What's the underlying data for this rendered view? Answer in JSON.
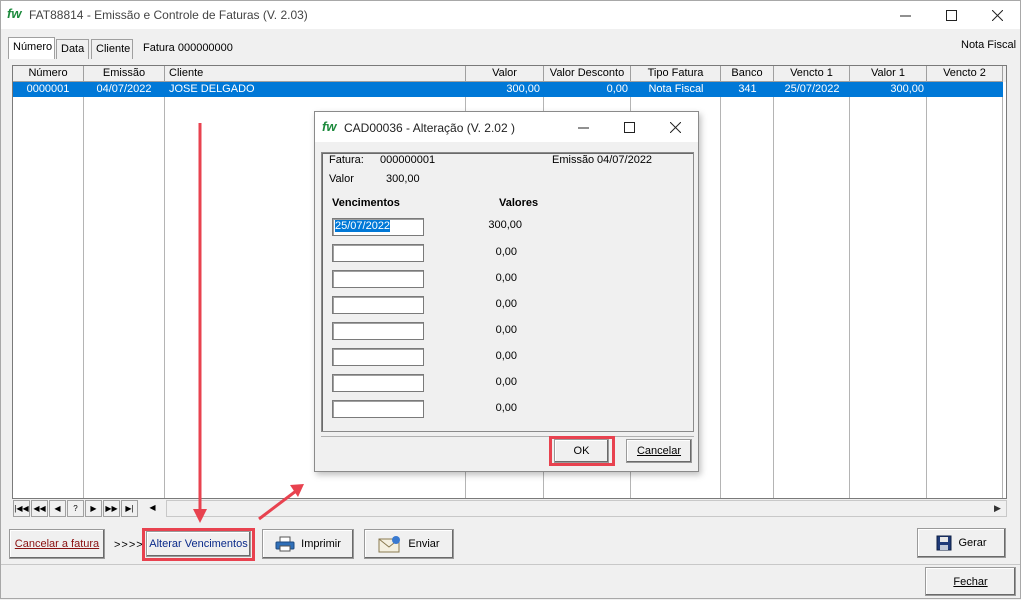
{
  "window": {
    "title": "FAT88814 - Emissão e Controle de  Faturas  (V. 2.03)",
    "logo": "fw"
  },
  "tabs": [
    "Número",
    "Data",
    "Cliente"
  ],
  "fatura_label": "Fatura 000000000",
  "nota_fiscal_label": "Nota Fiscal",
  "grid": {
    "columns": [
      "Número",
      "Emissão",
      "Cliente",
      "Valor",
      "Valor Desconto",
      "Tipo Fatura",
      "Banco",
      "Vencto 1",
      "Valor 1",
      "Vencto 2"
    ],
    "rows": [
      [
        "0000001",
        "04/07/2022",
        "JOSE DELGADO",
        "300,00",
        "0,00",
        "Nota Fiscal",
        "341",
        "25/07/2022",
        "300,00",
        ""
      ]
    ]
  },
  "navigator": [
    "|◀◀",
    "◀◀",
    "◀",
    "?",
    "▶",
    "▶▶",
    "▶|",
    "◀"
  ],
  "buttons": {
    "cancelar": "Cancelar a fatura",
    "arrows": ">>>>",
    "alterar": "Alterar Vencimentos",
    "imprimir": "Imprimir",
    "enviar": "Enviar",
    "gerar": "Gerar",
    "fechar": "Fechar"
  },
  "dialog": {
    "title": "CAD00036 - Alteração  (V.  2.02 )",
    "fatura_label": "Fatura:",
    "fatura_value": "000000001",
    "emissao_label": "Emissão",
    "emissao_value": "04/07/2022",
    "valor_label": "Valor",
    "valor_value": "300,00",
    "col_vencimentos": "Vencimentos",
    "col_valores": "Valores",
    "installments": [
      {
        "date": "25/07/2022",
        "value": "300,00"
      },
      {
        "date": "",
        "value": "0,00"
      },
      {
        "date": "",
        "value": "0,00"
      },
      {
        "date": "",
        "value": "0,00"
      },
      {
        "date": "",
        "value": "0,00"
      },
      {
        "date": "",
        "value": "0,00"
      },
      {
        "date": "",
        "value": "0,00"
      },
      {
        "date": "",
        "value": "0,00"
      }
    ],
    "ok": "OK",
    "cancelar": "Cancelar"
  },
  "colors": {
    "selection": "#0078d7",
    "highlight": "#e8424f",
    "logo": "#1c8a3c"
  }
}
